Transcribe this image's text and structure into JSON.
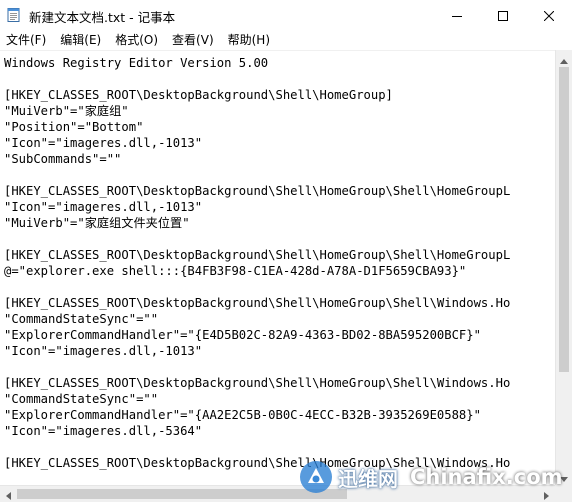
{
  "window": {
    "title": "新建文本文档.txt - 记事本",
    "icon": "notepad-icon",
    "controls": {
      "minimize": "minimize-icon",
      "maximize": "maximize-icon",
      "close": "close-icon"
    }
  },
  "menu": {
    "items": [
      "文件(F)",
      "编辑(E)",
      "格式(O)",
      "查看(V)",
      "帮助(H)"
    ]
  },
  "editor": {
    "lines": [
      "Windows Registry Editor Version 5.00",
      "",
      "[HKEY_CLASSES_ROOT\\DesktopBackground\\Shell\\HomeGroup]",
      "\"MuiVerb\"=\"家庭组\"",
      "\"Position\"=\"Bottom\"",
      "\"Icon\"=\"imageres.dll,-1013\"",
      "\"SubCommands\"=\"\"",
      "",
      "[HKEY_CLASSES_ROOT\\DesktopBackground\\Shell\\HomeGroup\\Shell\\HomeGroupL",
      "\"Icon\"=\"imageres.dll,-1013\"",
      "\"MuiVerb\"=\"家庭组文件夹位置\"",
      "",
      "[HKEY_CLASSES_ROOT\\DesktopBackground\\Shell\\HomeGroup\\Shell\\HomeGroupL",
      "@=\"explorer.exe shell:::{B4FB3F98-C1EA-428d-A78A-D1F5659CBA93}\"",
      "",
      "[HKEY_CLASSES_ROOT\\DesktopBackground\\Shell\\HomeGroup\\Shell\\Windows.Ho",
      "\"CommandStateSync\"=\"\"",
      "\"ExplorerCommandHandler\"=\"{E4D5B02C-82A9-4363-BD02-8BA595200BCF}\"",
      "\"Icon\"=\"imageres.dll,-1013\"",
      "",
      "[HKEY_CLASSES_ROOT\\DesktopBackground\\Shell\\HomeGroup\\Shell\\Windows.Ho",
      "\"CommandStateSync\"=\"\"",
      "\"ExplorerCommandHandler\"=\"{AA2E2C5B-0B0C-4ECC-B32B-3935269E0588}\"",
      "\"Icon\"=\"imageres.dll,-5364\"",
      "",
      "[HKEY_CLASSES_ROOT\\DesktopBackground\\Shell\\HomeGroup\\Shell\\Windows.Ho"
    ]
  },
  "watermark": {
    "logo": "xunwei-logo",
    "chinese": "迅维网",
    "english": "Chinafix.com"
  },
  "colors": {
    "accent": "#0078d7",
    "scrollbar_track": "#f0f0f0",
    "scrollbar_thumb": "#cdcdcd"
  }
}
